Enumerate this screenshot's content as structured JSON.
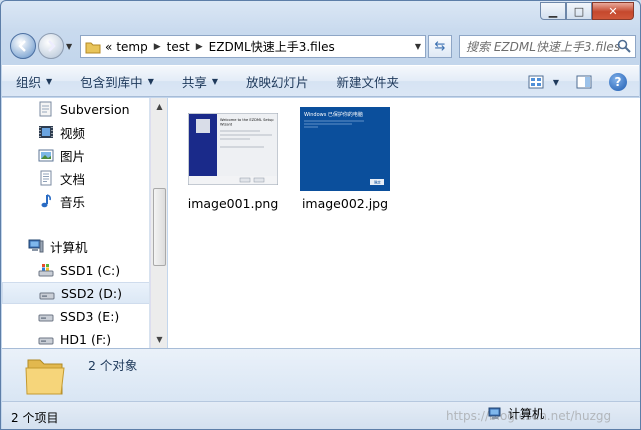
{
  "window": {
    "caption_buttons": {
      "minimize": "▁",
      "maximize": "□",
      "close": "✕"
    }
  },
  "address": {
    "overflow": "«",
    "crumbs": [
      "temp",
      "test",
      "EZDML快速上手3.files"
    ],
    "search_placeholder": "搜索 EZDML快速上手3.files"
  },
  "toolbar": {
    "organize": "组织",
    "include_in_library": "包含到库中",
    "share": "共享",
    "slideshow": "放映幻灯片",
    "new_folder": "新建文件夹"
  },
  "navpane": {
    "items": [
      {
        "label": "Subversion",
        "icon": "subversion-icon"
      },
      {
        "label": "视频",
        "icon": "video-library-icon"
      },
      {
        "label": "图片",
        "icon": "pictures-library-icon"
      },
      {
        "label": "文档",
        "icon": "documents-library-icon"
      },
      {
        "label": "音乐",
        "icon": "music-library-icon"
      },
      {
        "label": "计算机",
        "icon": "computer-icon"
      },
      {
        "label": "SSD1 (C:)",
        "icon": "system-drive-icon"
      },
      {
        "label": "SSD2 (D:)",
        "icon": "drive-icon"
      },
      {
        "label": "SSD3 (E:)",
        "icon": "drive-icon"
      },
      {
        "label": "HD1 (F:)",
        "icon": "drive-icon"
      }
    ]
  },
  "files": [
    {
      "name": "image001.png",
      "thumb_color": "#1a2a8a"
    },
    {
      "name": "image002.jpg",
      "thumb_color": "#0b4f9c"
    }
  ],
  "thumbnails": {
    "image001": {
      "title_line1": "Welcome to the EZDML Setup",
      "title_line2": "Wizard"
    },
    "image002": {
      "header": "Windows 已保护你的电脑",
      "button": "确定"
    }
  },
  "details": {
    "count": "2 个对象"
  },
  "status": {
    "items": "2 个项目",
    "location": "计算机",
    "watermark": "https://blog.csdn.net/huzgg"
  },
  "colors": {
    "accent": "#1e395b",
    "selection": "#dce8f5",
    "close_button": "#c5482d"
  }
}
